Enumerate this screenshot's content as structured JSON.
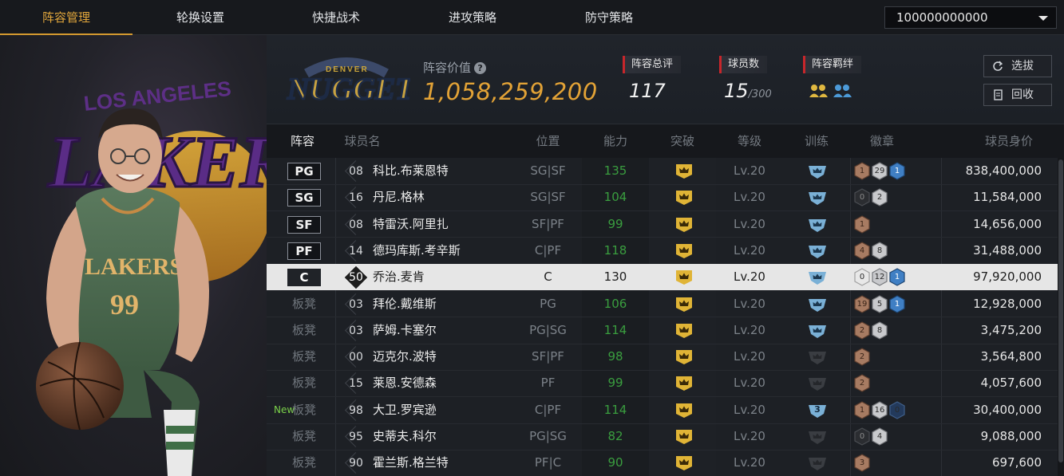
{
  "tabs": [
    {
      "label": "阵容管理",
      "active": true
    },
    {
      "label": "轮换设置",
      "active": false
    },
    {
      "label": "快捷战术",
      "active": false
    },
    {
      "label": "进攻策略",
      "active": false
    },
    {
      "label": "防守策略",
      "active": false
    }
  ],
  "coin_select": {
    "value": "100000000000"
  },
  "portrait": {
    "team_logo_text": "LAKERS",
    "jersey_text": "LAKERS",
    "jersey_number": "99",
    "banner_text": "LOS ANGELES"
  },
  "summary": {
    "team_logo_text": "NUGGETS",
    "team_logo_arc_text": "DENVER",
    "value_label": "阵容价值",
    "help_icon": "?",
    "value": "1,058,259,200",
    "overall_label": "阵容总评",
    "overall_value": "117",
    "players_label": "球员数",
    "players_value": "15",
    "players_max": "/300",
    "bond_label": "阵容羁绊",
    "buttons": {
      "select": "选拔",
      "recycle": "回收"
    }
  },
  "table": {
    "headers": {
      "lineup": "阵容",
      "name": "球员名",
      "position": "位置",
      "ability": "能力",
      "breakthrough": "突破",
      "level": "等级",
      "training": "训练",
      "badges": "徽章",
      "value": "球员身价"
    },
    "rows": [
      {
        "slot": "PG",
        "starter": true,
        "num": "08",
        "name": "科比.布莱恩特",
        "pos": "SG|SF",
        "ability": "135",
        "level": "Lv.20",
        "train": "light",
        "badges": [
          {
            "t": "bronze",
            "v": "1"
          },
          {
            "t": "silver",
            "v": "29"
          },
          {
            "t": "blue",
            "v": "1"
          }
        ],
        "price": "838,400,000"
      },
      {
        "slot": "SG",
        "starter": true,
        "num": "16",
        "name": "丹尼.格林",
        "pos": "SG|SF",
        "ability": "104",
        "level": "Lv.20",
        "train": "light",
        "badges": [
          {
            "t": "dark",
            "v": "0"
          },
          {
            "t": "silver",
            "v": "2"
          }
        ],
        "price": "11,584,000"
      },
      {
        "slot": "SF",
        "starter": true,
        "num": "08",
        "name": "特雷沃.阿里扎",
        "pos": "SF|PF",
        "ability": "99",
        "level": "Lv.20",
        "train": "light",
        "badges": [
          {
            "t": "bronze",
            "v": "1"
          }
        ],
        "price": "14,656,000"
      },
      {
        "slot": "PF",
        "starter": true,
        "num": "14",
        "name": "德玛库斯.考辛斯",
        "pos": "C|PF",
        "ability": "118",
        "level": "Lv.20",
        "train": "light",
        "badges": [
          {
            "t": "bronze",
            "v": "4"
          },
          {
            "t": "silver",
            "v": "8"
          }
        ],
        "price": "31,488,000"
      },
      {
        "slot": "C",
        "starter": true,
        "highlight": true,
        "num": "50",
        "name": "乔治.麦肯",
        "pos": "C",
        "ability": "130",
        "level": "Lv.20",
        "train": "light",
        "badges": [
          {
            "t": "white",
            "v": "0"
          },
          {
            "t": "silver",
            "v": "12"
          },
          {
            "t": "blue",
            "v": "1"
          }
        ],
        "price": "97,920,000"
      },
      {
        "slot": "板凳",
        "starter": false,
        "num": "03",
        "name": "拜伦.戴维斯",
        "pos": "PG",
        "ability": "106",
        "level": "Lv.20",
        "train": "light",
        "badges": [
          {
            "t": "bronze",
            "v": "19"
          },
          {
            "t": "silver",
            "v": "5"
          },
          {
            "t": "blue",
            "v": "1"
          }
        ],
        "price": "12,928,000"
      },
      {
        "slot": "板凳",
        "starter": false,
        "num": "03",
        "name": "萨姆.卡塞尔",
        "pos": "PG|SG",
        "ability": "114",
        "level": "Lv.20",
        "train": "light",
        "badges": [
          {
            "t": "bronze",
            "v": "2"
          },
          {
            "t": "silver",
            "v": "8"
          }
        ],
        "price": "3,475,200"
      },
      {
        "slot": "板凳",
        "starter": false,
        "num": "00",
        "name": "迈克尔.波特",
        "pos": "SF|PF",
        "ability": "98",
        "level": "Lv.20",
        "train": "dark",
        "badges": [
          {
            "t": "bronze",
            "v": "2"
          }
        ],
        "price": "3,564,800"
      },
      {
        "slot": "板凳",
        "starter": false,
        "num": "15",
        "name": "莱恩.安德森",
        "pos": "PF",
        "ability": "99",
        "level": "Lv.20",
        "train": "dark",
        "badges": [
          {
            "t": "bronze",
            "v": "2"
          }
        ],
        "price": "4,057,600"
      },
      {
        "slot": "板凳",
        "starter": false,
        "new": "New",
        "num": "98",
        "name": "大卫.罗宾逊",
        "pos": "C|PF",
        "ability": "114",
        "level": "Lv.20",
        "train": "three",
        "train_num": "3",
        "badges": [
          {
            "t": "bronze",
            "v": "1"
          },
          {
            "t": "silver",
            "v": "16"
          },
          {
            "t": "navy",
            "v": "0"
          }
        ],
        "price": "30,400,000"
      },
      {
        "slot": "板凳",
        "starter": false,
        "num": "95",
        "name": "史蒂夫.科尔",
        "pos": "PG|SG",
        "ability": "82",
        "level": "Lv.20",
        "train": "dark",
        "badges": [
          {
            "t": "dark",
            "v": "0"
          },
          {
            "t": "silver",
            "v": "4"
          }
        ],
        "price": "9,088,000"
      },
      {
        "slot": "板凳",
        "starter": false,
        "num": "90",
        "name": "霍兰斯.格兰特",
        "pos": "PF|C",
        "ability": "90",
        "level": "Lv.20",
        "train": "dark",
        "badges": [
          {
            "t": "bronze",
            "v": "3"
          }
        ],
        "price": "697,600"
      }
    ]
  }
}
